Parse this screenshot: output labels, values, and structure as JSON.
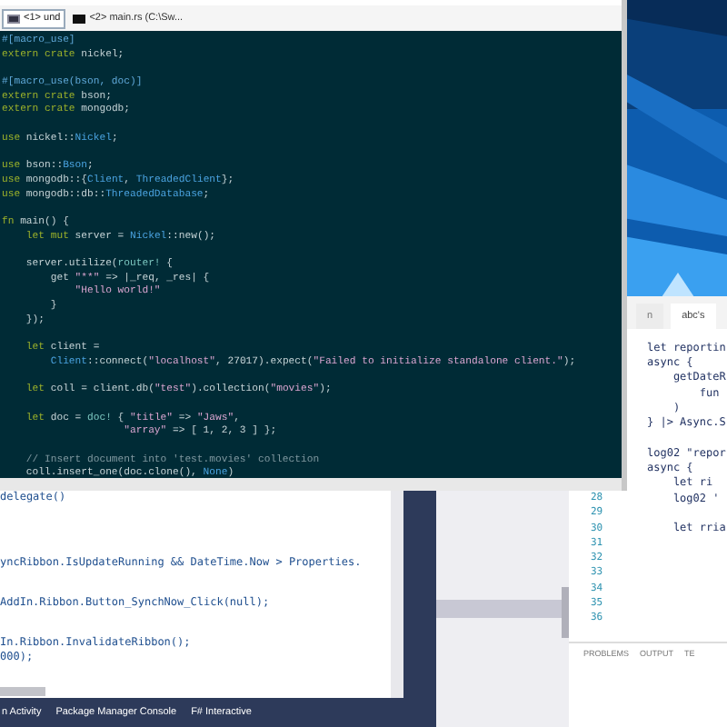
{
  "terminal": {
    "tabs": [
      {
        "label": "<1> und",
        "selected": true
      },
      {
        "label": "<2> main.rs (C:\\Sw...",
        "selected": false
      }
    ],
    "lines": [
      {
        "kind": "code",
        "segments": [
          {
            "kind": "attr",
            "text": "#[macro_use]"
          }
        ]
      },
      {
        "kind": "code",
        "segments": [
          {
            "kind": "kw",
            "text": "extern crate"
          },
          {
            "kind": "plain",
            "text": " nickel;"
          }
        ]
      },
      {
        "kind": "blank"
      },
      {
        "kind": "code",
        "segments": [
          {
            "kind": "attr",
            "text": "#[macro_use(bson, doc)]"
          }
        ]
      },
      {
        "kind": "code",
        "segments": [
          {
            "kind": "kw",
            "text": "extern crate"
          },
          {
            "kind": "plain",
            "text": " bson;"
          }
        ]
      },
      {
        "kind": "code",
        "segments": [
          {
            "kind": "kw",
            "text": "extern crate"
          },
          {
            "kind": "plain",
            "text": " mongodb;"
          }
        ]
      },
      {
        "kind": "blank"
      },
      {
        "kind": "code",
        "segments": [
          {
            "kind": "kw",
            "text": "use"
          },
          {
            "kind": "plain",
            "text": " nickel::"
          },
          {
            "kind": "id",
            "text": "Nickel"
          },
          {
            "kind": "plain",
            "text": ";"
          }
        ]
      },
      {
        "kind": "blank"
      },
      {
        "kind": "code",
        "segments": [
          {
            "kind": "kw",
            "text": "use"
          },
          {
            "kind": "plain",
            "text": " bson::"
          },
          {
            "kind": "id",
            "text": "Bson"
          },
          {
            "kind": "plain",
            "text": ";"
          }
        ]
      },
      {
        "kind": "code",
        "segments": [
          {
            "kind": "kw",
            "text": "use"
          },
          {
            "kind": "plain",
            "text": " mongodb::{"
          },
          {
            "kind": "id",
            "text": "Client"
          },
          {
            "kind": "plain",
            "text": ", "
          },
          {
            "kind": "id",
            "text": "ThreadedClient"
          },
          {
            "kind": "plain",
            "text": "};"
          }
        ]
      },
      {
        "kind": "code",
        "segments": [
          {
            "kind": "kw",
            "text": "use"
          },
          {
            "kind": "plain",
            "text": " mongodb::db::"
          },
          {
            "kind": "id",
            "text": "ThreadedDatabase"
          },
          {
            "kind": "plain",
            "text": ";"
          }
        ]
      },
      {
        "kind": "blank"
      },
      {
        "kind": "code",
        "segments": [
          {
            "kind": "kw",
            "text": "fn"
          },
          {
            "kind": "plain",
            "text": " main() {"
          }
        ]
      },
      {
        "kind": "code",
        "segments": [
          {
            "kind": "kw",
            "text": "    let mut"
          },
          {
            "kind": "plain",
            "text": " server = "
          },
          {
            "kind": "id",
            "text": "Nickel"
          },
          {
            "kind": "plain",
            "text": "::new();"
          }
        ]
      },
      {
        "kind": "blank"
      },
      {
        "kind": "code",
        "segments": [
          {
            "kind": "plain",
            "text": "    server.utilize("
          },
          {
            "kind": "macro",
            "text": "router!"
          },
          {
            "kind": "plain",
            "text": " {"
          }
        ]
      },
      {
        "kind": "code",
        "segments": [
          {
            "kind": "plain",
            "text": "        get "
          },
          {
            "kind": "str",
            "text": "\"**\""
          },
          {
            "kind": "plain",
            "text": " => |_req, _res| {"
          }
        ]
      },
      {
        "kind": "code",
        "segments": [
          {
            "kind": "str",
            "text": "            \"Hello world!\""
          }
        ]
      },
      {
        "kind": "code",
        "segments": [
          {
            "kind": "plain",
            "text": "        }"
          }
        ]
      },
      {
        "kind": "code",
        "segments": [
          {
            "kind": "plain",
            "text": "    });"
          }
        ]
      },
      {
        "kind": "blank"
      },
      {
        "kind": "code",
        "segments": [
          {
            "kind": "kw",
            "text": "    let"
          },
          {
            "kind": "plain",
            "text": " client ="
          }
        ]
      },
      {
        "kind": "code",
        "segments": [
          {
            "kind": "id",
            "text": "        Client"
          },
          {
            "kind": "plain",
            "text": "::connect("
          },
          {
            "kind": "str",
            "text": "\"localhost\""
          },
          {
            "kind": "plain",
            "text": ", 27017).expect("
          },
          {
            "kind": "str",
            "text": "\"Failed to initialize standalone client.\""
          },
          {
            "kind": "plain",
            "text": ");"
          }
        ]
      },
      {
        "kind": "blank"
      },
      {
        "kind": "code",
        "segments": [
          {
            "kind": "kw",
            "text": "    let"
          },
          {
            "kind": "plain",
            "text": " coll = client.db("
          },
          {
            "kind": "str",
            "text": "\"test\""
          },
          {
            "kind": "plain",
            "text": ").collection("
          },
          {
            "kind": "str",
            "text": "\"movies\""
          },
          {
            "kind": "plain",
            "text": ");"
          }
        ]
      },
      {
        "kind": "blank"
      },
      {
        "kind": "code",
        "segments": [
          {
            "kind": "kw",
            "text": "    let"
          },
          {
            "kind": "plain",
            "text": " doc = "
          },
          {
            "kind": "macro",
            "text": "doc!"
          },
          {
            "kind": "plain",
            "text": " { "
          },
          {
            "kind": "str",
            "text": "\"title\""
          },
          {
            "kind": "plain",
            "text": " => "
          },
          {
            "kind": "str",
            "text": "\"Jaws\""
          },
          {
            "kind": "plain",
            "text": ","
          }
        ]
      },
      {
        "kind": "code",
        "segments": [
          {
            "kind": "str",
            "text": "                    \"array\""
          },
          {
            "kind": "plain",
            "text": " => [ 1, 2, 3 ] };"
          }
        ]
      },
      {
        "kind": "blank"
      },
      {
        "kind": "code",
        "segments": [
          {
            "kind": "comment",
            "text": "    // Insert document into 'test.movies' collection"
          }
        ]
      },
      {
        "kind": "code",
        "segments": [
          {
            "kind": "plain",
            "text": "    coll.insert_one(doc.clone(), "
          },
          {
            "kind": "id",
            "text": "None"
          },
          {
            "kind": "plain",
            "text": ")"
          }
        ]
      }
    ]
  },
  "visual_studio": {
    "lines": [
      {
        "kind": "code",
        "text": "delegate()"
      },
      {
        "kind": "blank"
      },
      {
        "kind": "blank"
      },
      {
        "kind": "blank"
      },
      {
        "kind": "blank"
      },
      {
        "kind": "code",
        "text": "yncRibbon.IsUpdateRunning && DateTime.Now > Properties."
      },
      {
        "kind": "blank"
      },
      {
        "kind": "blank"
      },
      {
        "kind": "code",
        "text": "AddIn.Ribbon.Button_SynchNow_Click(null);"
      },
      {
        "kind": "blank"
      },
      {
        "kind": "blank"
      },
      {
        "kind": "code",
        "text": "In.Ribbon.InvalidateRibbon();"
      },
      {
        "kind": "code",
        "text": "000);"
      }
    ],
    "tool_tabs": [
      "n Activity",
      "Package Manager Console",
      "F# Interactive"
    ]
  },
  "code_editor": {
    "tabs": [
      {
        "label": "n",
        "selected": false
      },
      {
        "label": "abc's",
        "selected": true
      }
    ],
    "rows": [
      {
        "code": "let reportin"
      },
      {
        "code": "async {"
      },
      {
        "code": "    getDateR"
      },
      {
        "code": "        fun"
      },
      {
        "code": "    )"
      },
      {
        "code": "} |> Async.S"
      },
      {},
      {
        "code": "log02 \"repor"
      },
      {
        "code": "async {"
      },
      {
        "code": "    let ri"
      },
      {
        "line_number": "28",
        "code": "    log02 '"
      },
      {
        "line_number": "29"
      },
      {
        "line_number": "30",
        "code": "    let rria"
      },
      {
        "line_number": "31"
      },
      {
        "line_number": "32"
      },
      {
        "line_number": "33"
      },
      {
        "line_number": "34"
      },
      {
        "line_number": "35"
      },
      {
        "line_number": "36"
      }
    ],
    "panel_tabs": [
      "PROBLEMS",
      "OUTPUT",
      "TE"
    ]
  }
}
